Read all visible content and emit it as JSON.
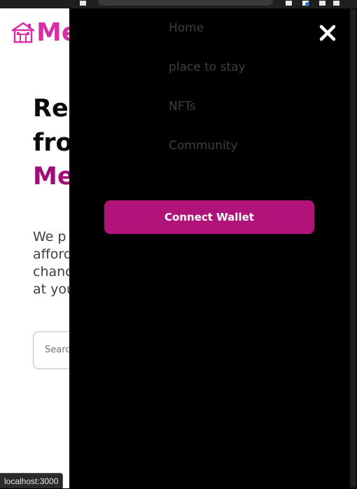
{
  "colors": {
    "brand_pink": "#d62fa8",
    "brand_magenta": "#a10d76",
    "button_bg": "#b0137a",
    "overlay_bg": "#000000",
    "nav_text": "#3f3f3f"
  },
  "page": {
    "logo_icon": "house-icon",
    "logo_text": "Me",
    "hero": {
      "line1": "Re",
      "line2": "fro",
      "line3": "Me"
    },
    "description": {
      "line1": "We p",
      "line2": "afford",
      "line3": "chanc",
      "line4": "at you"
    },
    "search": {
      "placeholder": "Search"
    }
  },
  "menu": {
    "items": [
      {
        "label": "Home"
      },
      {
        "label": "place to stay"
      },
      {
        "label": "NFTs"
      },
      {
        "label": "Community"
      }
    ],
    "close_icon": "close-icon",
    "connect_wallet_label": "Connect Wallet"
  },
  "status": {
    "url": "localhost:3000"
  }
}
